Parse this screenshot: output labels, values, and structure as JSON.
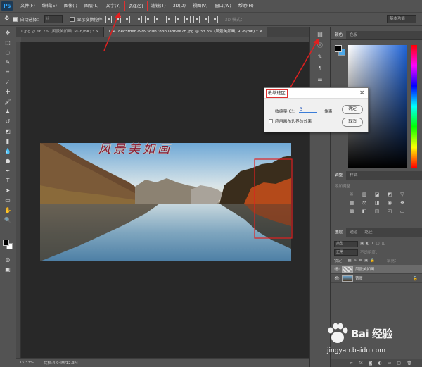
{
  "app": {
    "logo": "Ps"
  },
  "menu": [
    "文件(F)",
    "编辑(E)",
    "图像(I)",
    "图层(L)",
    "文字(Y)",
    "选择(S)",
    "滤镜(T)",
    "3D(D)",
    "视图(V)",
    "窗口(W)",
    "帮助(H)"
  ],
  "options": {
    "auto_select_label": "自动选择：",
    "auto_select_value": "组",
    "show_transform_label": "显示变换控件",
    "mode_3d_label": "3D 模式：",
    "workspace": "基本功能"
  },
  "tabs": [
    {
      "label": "1.jpg @ 66.7% (风景美如画, RGB/8#) * ×",
      "active": false
    },
    {
      "label": "11418ec5fde829d93d0b788b0a86ee7b.jpg @ 33.3% (风景美如画, RGB/8#) * ×",
      "active": true
    }
  ],
  "image": {
    "title_text": "风景美如画"
  },
  "status": {
    "zoom": "33.33%",
    "doc": "文档:4.94M/12.3M"
  },
  "dialog": {
    "title": "收缩选区",
    "shrink_label": "收缩量(C):",
    "shrink_value": "3",
    "unit": "像素",
    "canvas_edge_label": "应用画布边界的效果",
    "ok_label": "确定",
    "cancel_label": "取消"
  },
  "color_panel": {
    "tabs": [
      "颜色",
      "色板"
    ],
    "fg_color": "#000000",
    "bg_color": "#4da8e8"
  },
  "adjust_panel": {
    "tabs": [
      "调整",
      "样式"
    ],
    "add_label": "添加调整"
  },
  "layers_panel": {
    "tabs": [
      "图层",
      "通道",
      "路径"
    ],
    "kind": "类型",
    "blend": "正常",
    "opacity_label": "不透明度：",
    "lock_label": "锁定：",
    "fill_label": "填充：",
    "layers": [
      {
        "name": "风景美如画",
        "selected": true,
        "thumb": "text"
      },
      {
        "name": "背景",
        "selected": false,
        "thumb": "photo"
      }
    ]
  },
  "watermark": {
    "brand": "Bai 经验",
    "url": "jingyan.baidu.com"
  }
}
